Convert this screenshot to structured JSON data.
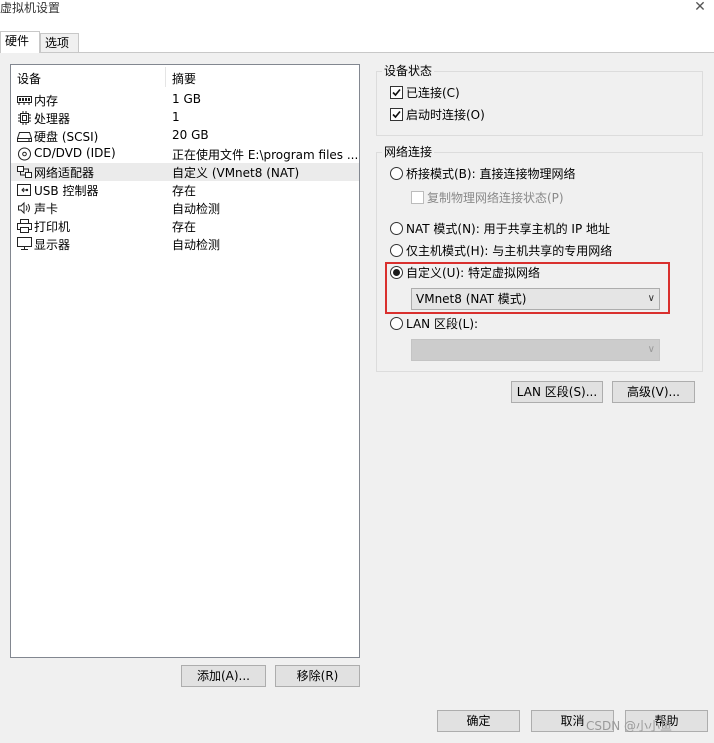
{
  "window": {
    "title": "虚拟机设置",
    "close_glyph": "✕"
  },
  "tabs": [
    {
      "label": "硬件",
      "active": true
    },
    {
      "label": "选项",
      "active": false
    }
  ],
  "device_list": {
    "columns": [
      "设备",
      "摘要"
    ],
    "rows": [
      {
        "name": "内存",
        "summary": "1 GB",
        "icon": "memory-icon"
      },
      {
        "name": "处理器",
        "summary": "1",
        "icon": "processor-icon"
      },
      {
        "name": "硬盘 (SCSI)",
        "summary": "20 GB",
        "icon": "harddisk-icon"
      },
      {
        "name": "CD/DVD (IDE)",
        "summary": "正在使用文件 E:\\program files ...",
        "icon": "cd-dvd-icon"
      },
      {
        "name": "网络适配器",
        "summary": "自定义 (VMnet8 (NAT)",
        "icon": "network-adapter-icon",
        "selected": true
      },
      {
        "name": "USB 控制器",
        "summary": "存在",
        "icon": "usb-icon"
      },
      {
        "name": "声卡",
        "summary": "自动检测",
        "icon": "sound-card-icon"
      },
      {
        "name": "打印机",
        "summary": "存在",
        "icon": "printer-icon"
      },
      {
        "name": "显示器",
        "summary": "自动检测",
        "icon": "display-icon"
      }
    ],
    "add_button": "添加(A)...",
    "remove_button": "移除(R)"
  },
  "device_status": {
    "legend": "设备状态",
    "connected": {
      "label": "已连接(C)",
      "checked": true
    },
    "connect_at_power_on": {
      "label": "启动时连接(O)",
      "checked": true
    }
  },
  "network_connection": {
    "legend": "网络连接",
    "bridged": {
      "label": "桥接模式(B): 直接连接物理网络",
      "selected": false
    },
    "replicate": {
      "label": "复制物理网络连接状态(P)",
      "checked": false,
      "disabled": true
    },
    "nat": {
      "label": "NAT 模式(N): 用于共享主机的 IP 地址",
      "selected": false
    },
    "host_only": {
      "label": "仅主机模式(H): 与主机共享的专用网络",
      "selected": false
    },
    "custom": {
      "label": "自定义(U): 特定虚拟网络",
      "selected": true,
      "value": "VMnet8 (NAT 模式)"
    },
    "lan_segment": {
      "label": "LAN 区段(L):",
      "selected": false,
      "value": ""
    }
  },
  "buttons": {
    "lan_segments": "LAN 区段(S)...",
    "advanced": "高级(V)...",
    "ok": "确定",
    "cancel": "取消",
    "help": "帮助"
  },
  "watermark": "CSDN @小小鱼",
  "colors": {
    "highlight_border": "#d9302e",
    "dialog_bg": "#f0f0f0",
    "selected_row": "#ebebeb"
  }
}
